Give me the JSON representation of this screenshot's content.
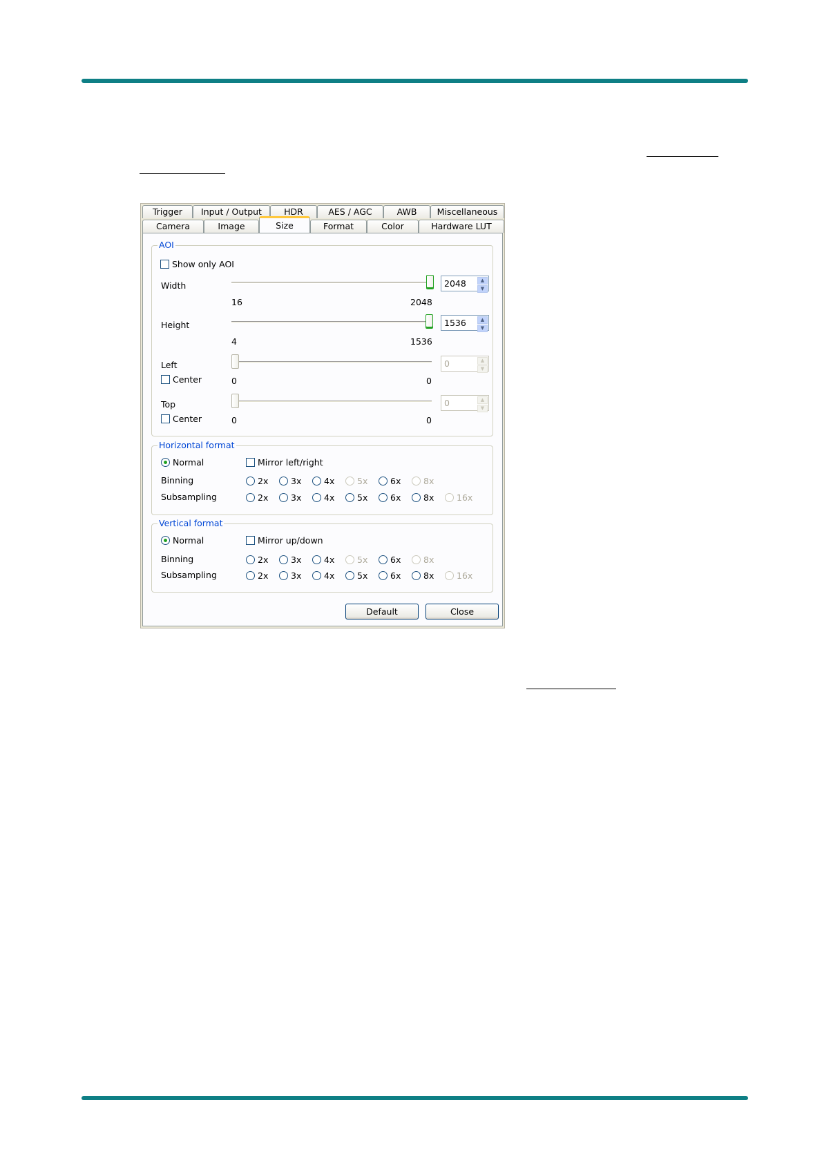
{
  "tabs_row1": [
    "Trigger",
    "Input / Output",
    "HDR",
    "AES / AGC",
    "AWB",
    "Miscellaneous"
  ],
  "tabs_row2": [
    "Camera",
    "Image",
    "Size",
    "Format",
    "Color",
    "Hardware LUT"
  ],
  "aoi": {
    "legend": "AOI",
    "show_only_aoi": "Show only AOI",
    "width": {
      "label": "Width",
      "min": "16",
      "max": "2048",
      "value": "2048",
      "level": 1.0
    },
    "height": {
      "label": "Height",
      "min": "4",
      "max": "1536",
      "value": "1536",
      "level": 1.0
    },
    "left": {
      "label": "Left",
      "center": "Center",
      "min": "0",
      "max": "0",
      "value": "0",
      "level": 0.0
    },
    "top": {
      "label": "Top",
      "center": "Center",
      "min": "0",
      "max": "0",
      "value": "0",
      "level": 0.0
    }
  },
  "horizontal": {
    "legend": "Horizontal format",
    "normal": "Normal",
    "mirror": "Mirror left/right",
    "binning_label": "Binning",
    "subsampling_label": "Subsampling",
    "binning": [
      "2x",
      "3x",
      "4x",
      "5x",
      "6x",
      "8x"
    ],
    "binning_disabled": [
      false,
      false,
      false,
      true,
      false,
      true
    ],
    "subsampling": [
      "2x",
      "3x",
      "4x",
      "5x",
      "6x",
      "8x",
      "16x"
    ],
    "subsampling_disabled": [
      false,
      false,
      false,
      false,
      false,
      false,
      true
    ]
  },
  "vertical": {
    "legend": "Vertical format",
    "normal": "Normal",
    "mirror": "Mirror up/down",
    "binning_label": "Binning",
    "subsampling_label": "Subsampling",
    "binning": [
      "2x",
      "3x",
      "4x",
      "5x",
      "6x",
      "8x"
    ],
    "binning_disabled": [
      false,
      false,
      false,
      true,
      false,
      true
    ],
    "subsampling": [
      "2x",
      "3x",
      "4x",
      "5x",
      "6x",
      "8x",
      "16x"
    ],
    "subsampling_disabled": [
      false,
      false,
      false,
      false,
      false,
      false,
      true
    ]
  },
  "buttons": {
    "default": "Default",
    "close": "Close"
  },
  "colors": {
    "rule": "#0e7f85",
    "legend": "#0046d5",
    "active_tab": "#ffc83c",
    "radio_dot": "#21a121"
  }
}
